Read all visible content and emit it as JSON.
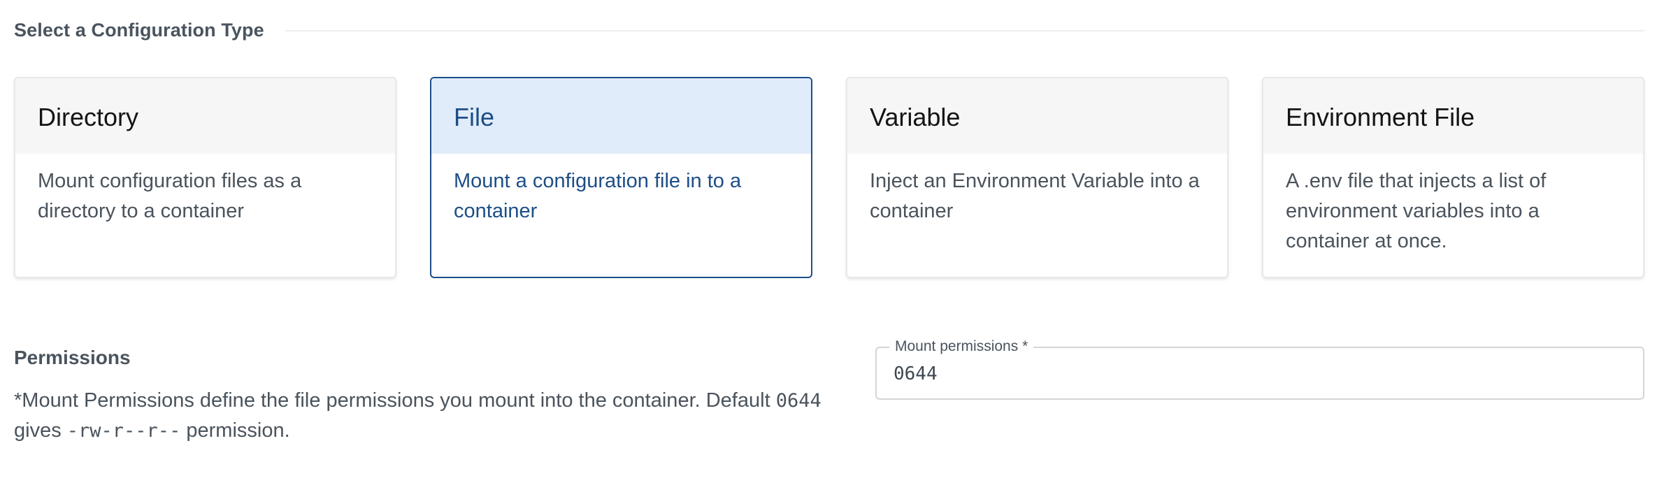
{
  "section": {
    "title": "Select a Configuration Type"
  },
  "cards": [
    {
      "title": "Directory",
      "description": "Mount configuration files as a directory to a container",
      "selected": false
    },
    {
      "title": "File",
      "description": "Mount a configuration file in to a container",
      "selected": true
    },
    {
      "title": "Variable",
      "description": "Inject an Environment Variable into a container",
      "selected": false
    },
    {
      "title": "Environment File",
      "description": "A .env file that injects a list of environment variables into a container at once.",
      "selected": false
    }
  ],
  "permissions": {
    "title": "Permissions",
    "desc_prefix": "*Mount Permissions define the file permissions you mount into the container. Default ",
    "default_value": "0644",
    "desc_middle": " gives ",
    "permission_string": "-rw-r--r--",
    "desc_suffix": " permission."
  },
  "mount_field": {
    "label": "Mount permissions *",
    "value": "0644"
  },
  "colors": {
    "accent": "#1d4e86",
    "selected_header_bg": "#e1ecfa",
    "card_header_bg": "#f6f6f6"
  }
}
